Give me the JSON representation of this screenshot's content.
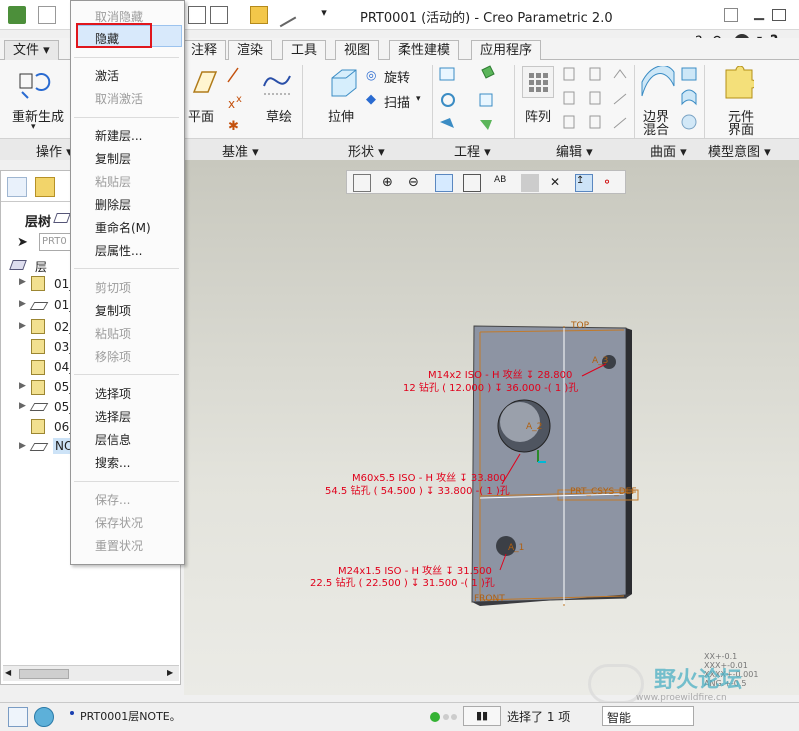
{
  "window": {
    "title": "PRT0001 (活动的) - Creo Parametric 2.0"
  },
  "tabs": [
    "文件 ▾",
    "注释",
    "渲染",
    "工具",
    "视图",
    "柔性建模",
    "应用程序"
  ],
  "ribbon": {
    "regenerate": "重新生成",
    "plane": "平面",
    "sketch": "草绘",
    "extrude": "拉伸",
    "revolve": "旋转",
    "sweep": "扫描",
    "pattern": "阵列",
    "boundary_blend": [
      "边界",
      "混合"
    ],
    "component_interface": [
      "元件",
      "界面"
    ],
    "groups": [
      "操作 ▾",
      "基准 ▾",
      "形状 ▾",
      "工程 ▾",
      "编辑 ▾",
      "曲面 ▾",
      "模型意图 ▾"
    ]
  },
  "context_menu": {
    "items": [
      {
        "label": "取消隐藏",
        "enabled": false
      },
      {
        "label": "隐藏",
        "enabled": true,
        "highlighted": true
      },
      {
        "label": "激活",
        "enabled": true
      },
      {
        "label": "取消激活",
        "enabled": false
      },
      {
        "label": "新建层...",
        "enabled": true
      },
      {
        "label": "复制层",
        "enabled": true
      },
      {
        "label": "粘贴层",
        "enabled": false
      },
      {
        "label": "删除层",
        "enabled": true
      },
      {
        "label": "重命名(M)",
        "enabled": true
      },
      {
        "label": "层属性...",
        "enabled": true
      },
      {
        "label": "剪切项",
        "enabled": false
      },
      {
        "label": "复制项",
        "enabled": true
      },
      {
        "label": "粘贴项",
        "enabled": false
      },
      {
        "label": "移除项",
        "enabled": false
      },
      {
        "label": "选择项",
        "enabled": true
      },
      {
        "label": "选择层",
        "enabled": true
      },
      {
        "label": "层信息",
        "enabled": true
      },
      {
        "label": "搜索...",
        "enabled": true
      },
      {
        "label": "保存...",
        "enabled": false
      },
      {
        "label": "保存状况",
        "enabled": false
      },
      {
        "label": "重置状况",
        "enabled": false
      }
    ]
  },
  "left_panel": {
    "title": "层树",
    "search_text": "PRT0",
    "root_label": "层",
    "layers": [
      "01_",
      "01_",
      "02_",
      "03_",
      "04_",
      "05_",
      "05_",
      "06_",
      "NOT"
    ]
  },
  "model": {
    "annotations": [
      {
        "line1": "M14x2 ISO - H 攻丝 ↧ 28.800",
        "line2": "12 钻孔 ( 12.000 ) ↧ 36.000 -( 1 )孔"
      },
      {
        "line1": "M60x5.5 ISO - H 攻丝 ↧ 33.800",
        "line2": "54.5 钻孔 ( 54.500 ) ↧ 33.800 -( 1 )孔"
      },
      {
        "line1": "M24x1.5 ISO - H 攻丝 ↧ 31.500",
        "line2": "22.5 钻孔 ( 22.500 ) ↧ 31.500 -( 1 )孔"
      }
    ],
    "labels": [
      "TOP",
      "A_3",
      "A_2",
      "PRT_CSYS_DEF",
      "A_1",
      "FRONT"
    ],
    "tolerances": [
      "XX+-0.1",
      "XXX+-0.01",
      "XXXX+-0.001",
      "ANG.+-0.5"
    ]
  },
  "watermark": {
    "title": "野火论坛",
    "url": "www.proewildfire.cn"
  },
  "status": {
    "message": "PRT0001层NOTE。",
    "selection": "选择了 1 项",
    "filter": "智能"
  }
}
